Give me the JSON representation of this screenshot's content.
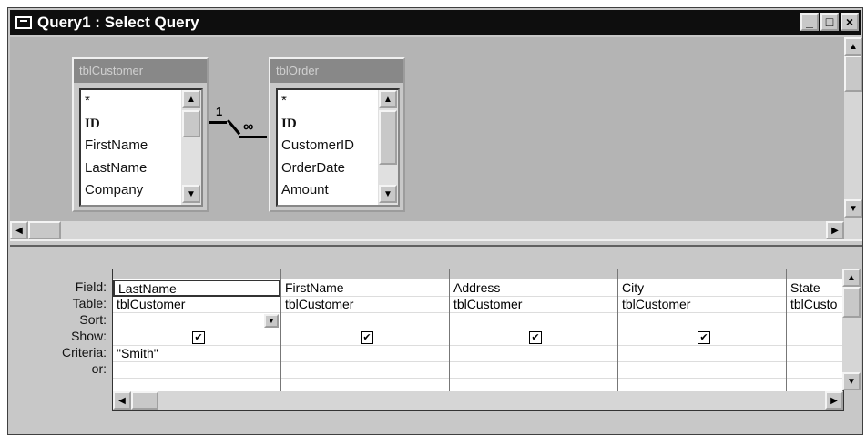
{
  "window": {
    "title": "Query1 : Select Query",
    "buttons": {
      "minimize": "_",
      "maximize": "□",
      "close": "×"
    }
  },
  "tables": [
    {
      "name": "tblCustomer",
      "fields": [
        "*",
        "ID",
        "FirstName",
        "LastName",
        "Company"
      ]
    },
    {
      "name": "tblOrder",
      "fields": [
        "*",
        "ID",
        "CustomerID",
        "OrderDate",
        "Amount"
      ]
    }
  ],
  "relationship": {
    "one": "1",
    "many": "∞"
  },
  "grid": {
    "row_labels": [
      "Field:",
      "Table:",
      "Sort:",
      "Show:",
      "Criteria:",
      "or:"
    ],
    "columns": [
      {
        "field": "LastName",
        "table": "tblCustomer",
        "sort": "",
        "show": true,
        "criteria": "\"Smith\"",
        "or": ""
      },
      {
        "field": "FirstName",
        "table": "tblCustomer",
        "sort": "",
        "show": true,
        "criteria": "",
        "or": ""
      },
      {
        "field": "Address",
        "table": "tblCustomer",
        "sort": "",
        "show": true,
        "criteria": "",
        "or": ""
      },
      {
        "field": "City",
        "table": "tblCustomer",
        "sort": "",
        "show": true,
        "criteria": "",
        "or": ""
      },
      {
        "field": "State",
        "table": "tblCusto",
        "sort": "",
        "show": false,
        "criteria": "",
        "or": ""
      }
    ]
  },
  "icons": {
    "app": "query-window-icon",
    "up": "arrow-up-icon",
    "down": "arrow-down-icon",
    "left": "arrow-left-icon",
    "right": "arrow-right-icon",
    "check": "checkmark-icon"
  },
  "glyphs": {
    "up": "▲",
    "down": "▼",
    "left": "◀",
    "right": "▶",
    "check": "✔"
  }
}
